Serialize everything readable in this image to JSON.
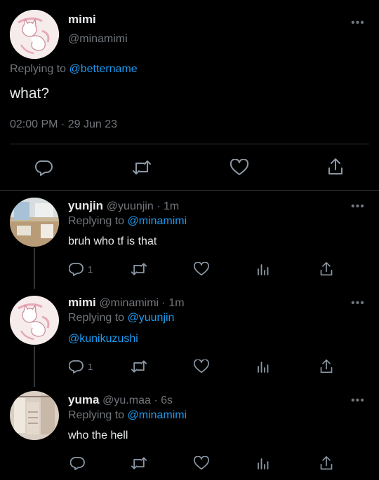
{
  "main_tweet": {
    "name": "mimi",
    "handle": "@minamimi",
    "replying_prefix": "Replying to",
    "replying_to": "@bettername",
    "text": "what?",
    "timestamp": "02:00 PM · 29 Jun 23",
    "more_icon": "more-horizontal-icon"
  },
  "replies": [
    {
      "name": "yunjin",
      "meta": "@yuunjin · 1m",
      "replying_prefix": "Replying to",
      "replying_to": "@minamimi",
      "text": "bruh who tf is that",
      "reply_count": "1"
    },
    {
      "name": "mimi",
      "meta": "@minamimi · 1m",
      "replying_prefix": "Replying to",
      "replying_to": "@yuunjin",
      "text": "@kunikuzushi",
      "reply_count": "1"
    },
    {
      "name": "yuma",
      "meta": "@yu.maa · 6s",
      "replying_prefix": "Replying to",
      "replying_to": "@minamimi",
      "text": "who the hell",
      "reply_count": ""
    }
  ],
  "colors": {
    "background": "#000000",
    "text": "#e7e9ea",
    "muted": "#71767b",
    "link": "#1d9bf0",
    "divider": "#2f3336"
  },
  "icons": [
    "reply-icon",
    "retweet-icon",
    "like-icon",
    "views-icon",
    "share-icon",
    "more-horizontal-icon"
  ]
}
